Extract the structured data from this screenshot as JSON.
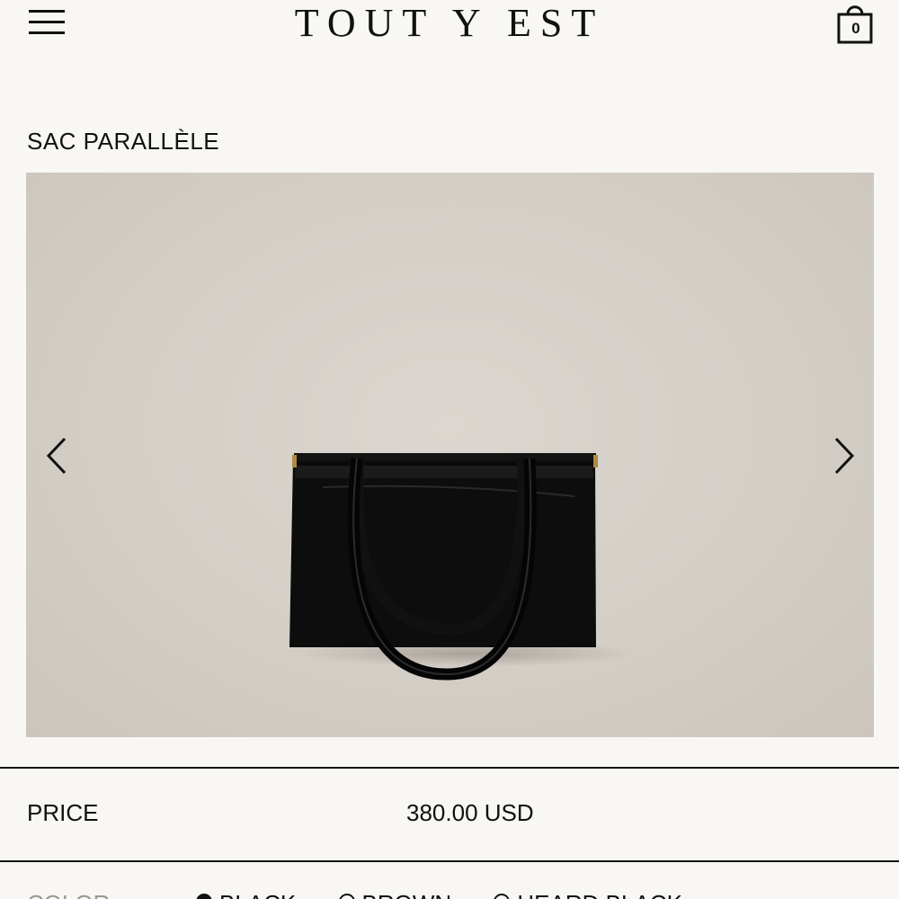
{
  "header": {
    "brand": "TOUT Y EST",
    "menu_icon": "hamburger-menu-icon",
    "cart_icon": "shopping-bag-icon",
    "cart_count": "0"
  },
  "product": {
    "title": "SAC PARALLÈLE",
    "gallery": {
      "prev_icon": "chevron-left-icon",
      "next_icon": "chevron-right-icon"
    },
    "price_label": "PRICE",
    "price_value": "380.00 USD",
    "color_label": "COLOR",
    "color_options": [
      {
        "label": "BLACK",
        "selected": true
      },
      {
        "label": "BROWN",
        "selected": false
      },
      {
        "label": "HEARD BLACK",
        "selected": false
      }
    ]
  },
  "colors": {
    "background": "#f8f7f3",
    "text": "#111111",
    "muted_label": "#9a9893",
    "photo_backdrop": "#d6d1ca",
    "bag": "#0d0d0d",
    "hardware": "#b08a3e"
  }
}
